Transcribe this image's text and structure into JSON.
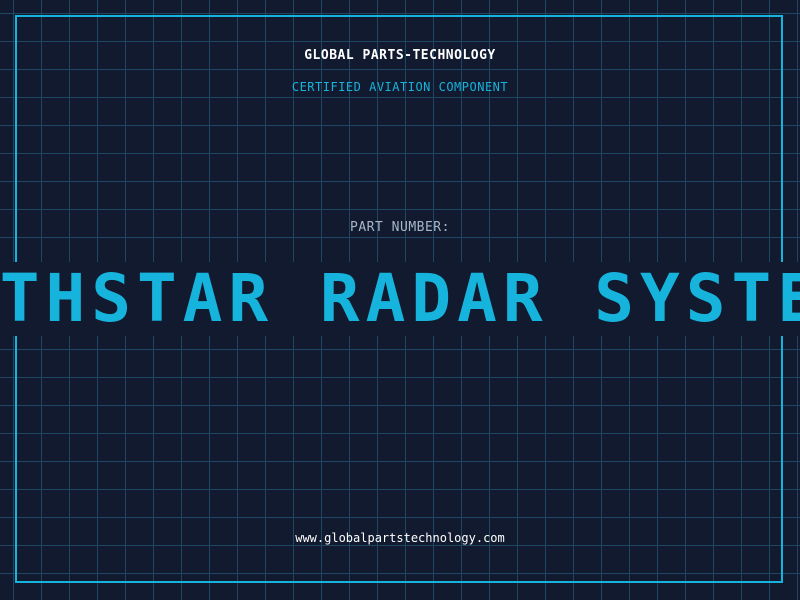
{
  "header": {
    "company": "GLOBAL PARTS-TECHNOLOGY",
    "subtitle": "CERTIFIED AVIATION COMPONENT"
  },
  "part": {
    "label": "PART NUMBER:",
    "value": "NORTHSTAR RADAR SYSTEM",
    "visible_text": "RTHSTAR RADAR SYSTE"
  },
  "footer": {
    "website": "www.globalpartstechnology.com"
  },
  "colors": {
    "background": "#111a2e",
    "grid": "#1f4763",
    "accent": "#16b4dc",
    "text_primary": "#ffffff",
    "text_muted": "#a7b6c8"
  }
}
